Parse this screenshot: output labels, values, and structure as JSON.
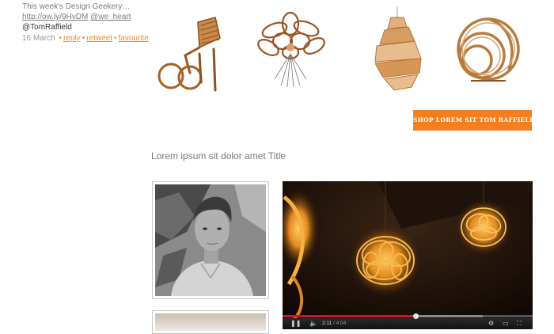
{
  "tweet": {
    "text": "This week's Design Geekery…",
    "link": "http://ow.ly/9HvDM",
    "mention": "@we_heart",
    "author": "@TomRaffield",
    "date": "16 March",
    "actions": {
      "reply": "reply",
      "retweet": "retweet",
      "favourite": "favourite"
    },
    "separator": "•"
  },
  "products": [
    "chair",
    "flower-pendant",
    "spiral-pendant",
    "sphere-sculpture"
  ],
  "shop_button": "SHOP LOREM SIT TOM RAFFIELD",
  "section_title": "Lorem ipsum sit dolor amet Title",
  "video": {
    "current_time": "2:11",
    "duration": "4:04",
    "progress_played": 0.533,
    "progress_loaded": 0.8
  },
  "colors": {
    "accent": "#f47f20",
    "link": "#f18a24",
    "wood": "#b0692b"
  }
}
